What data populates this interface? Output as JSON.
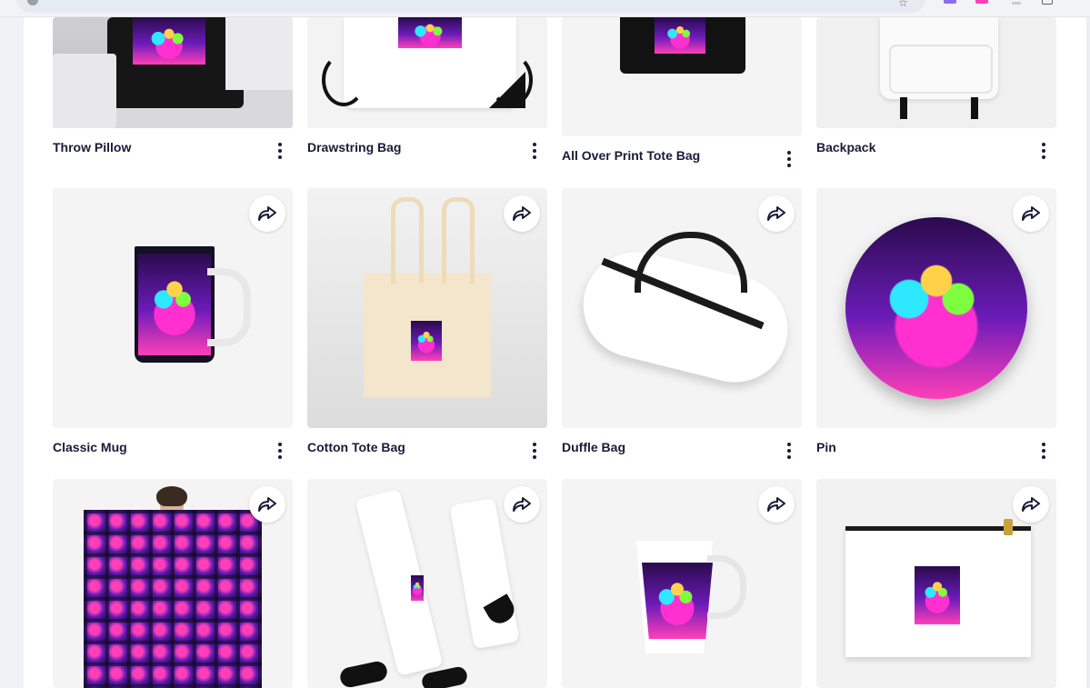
{
  "browser": {
    "star_icon": "star-icon"
  },
  "products": [
    {
      "title": "Throw Pillow"
    },
    {
      "title": "Drawstring Bag"
    },
    {
      "title": "All Over Print Tote Bag"
    },
    {
      "title": "Backpack"
    },
    {
      "title": "Classic Mug"
    },
    {
      "title": "Cotton Tote Bag"
    },
    {
      "title": "Duffle Bag"
    },
    {
      "title": "Pin"
    },
    {
      "title": ""
    },
    {
      "title": ""
    },
    {
      "title": ""
    },
    {
      "title": ""
    }
  ],
  "colors": {
    "title_text": "#1b1a38",
    "page_bg": "#ffffff",
    "side_bg": "#f1f2f6"
  }
}
